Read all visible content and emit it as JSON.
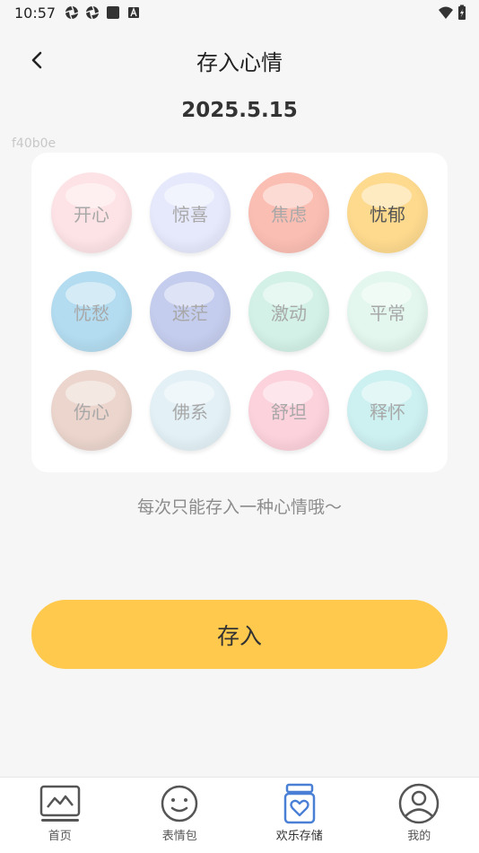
{
  "status_bar": {
    "time": "10:57"
  },
  "header": {
    "title": "存入心情"
  },
  "date": "2025.5.15",
  "color_code": "f40b0e",
  "moods": [
    {
      "label": "开心",
      "color": "#fde3e6",
      "selected": false
    },
    {
      "label": "惊喜",
      "color": "#e6e9fc",
      "selected": false
    },
    {
      "label": "焦虑",
      "color": "#fbbeb3",
      "selected": false
    },
    {
      "label": "忧郁",
      "color": "#fdda8e",
      "selected": true
    },
    {
      "label": "忧愁",
      "color": "#b3dcf0",
      "selected": false
    },
    {
      "label": "迷茫",
      "color": "#c5cdee",
      "selected": false
    },
    {
      "label": "激动",
      "color": "#d3f1e7",
      "selected": false
    },
    {
      "label": "平常",
      "color": "#e3f7ef",
      "selected": false
    },
    {
      "label": "伤心",
      "color": "#ebd5cd",
      "selected": false
    },
    {
      "label": "佛系",
      "color": "#e3f1f6",
      "selected": false
    },
    {
      "label": "舒坦",
      "color": "#fcd2dc",
      "selected": false
    },
    {
      "label": "释怀",
      "color": "#cdf0f1",
      "selected": false
    }
  ],
  "hint": "每次只能存入一种心情哦～",
  "save_label": "存入",
  "accent_color": "#ffc94d",
  "tabs": [
    {
      "label": "首页",
      "icon": "chart-board-icon"
    },
    {
      "label": "表情包",
      "icon": "smiley-face-icon"
    },
    {
      "label": "欢乐存储",
      "icon": "heart-jar-icon",
      "active": true
    },
    {
      "label": "我的",
      "icon": "user-icon"
    }
  ]
}
